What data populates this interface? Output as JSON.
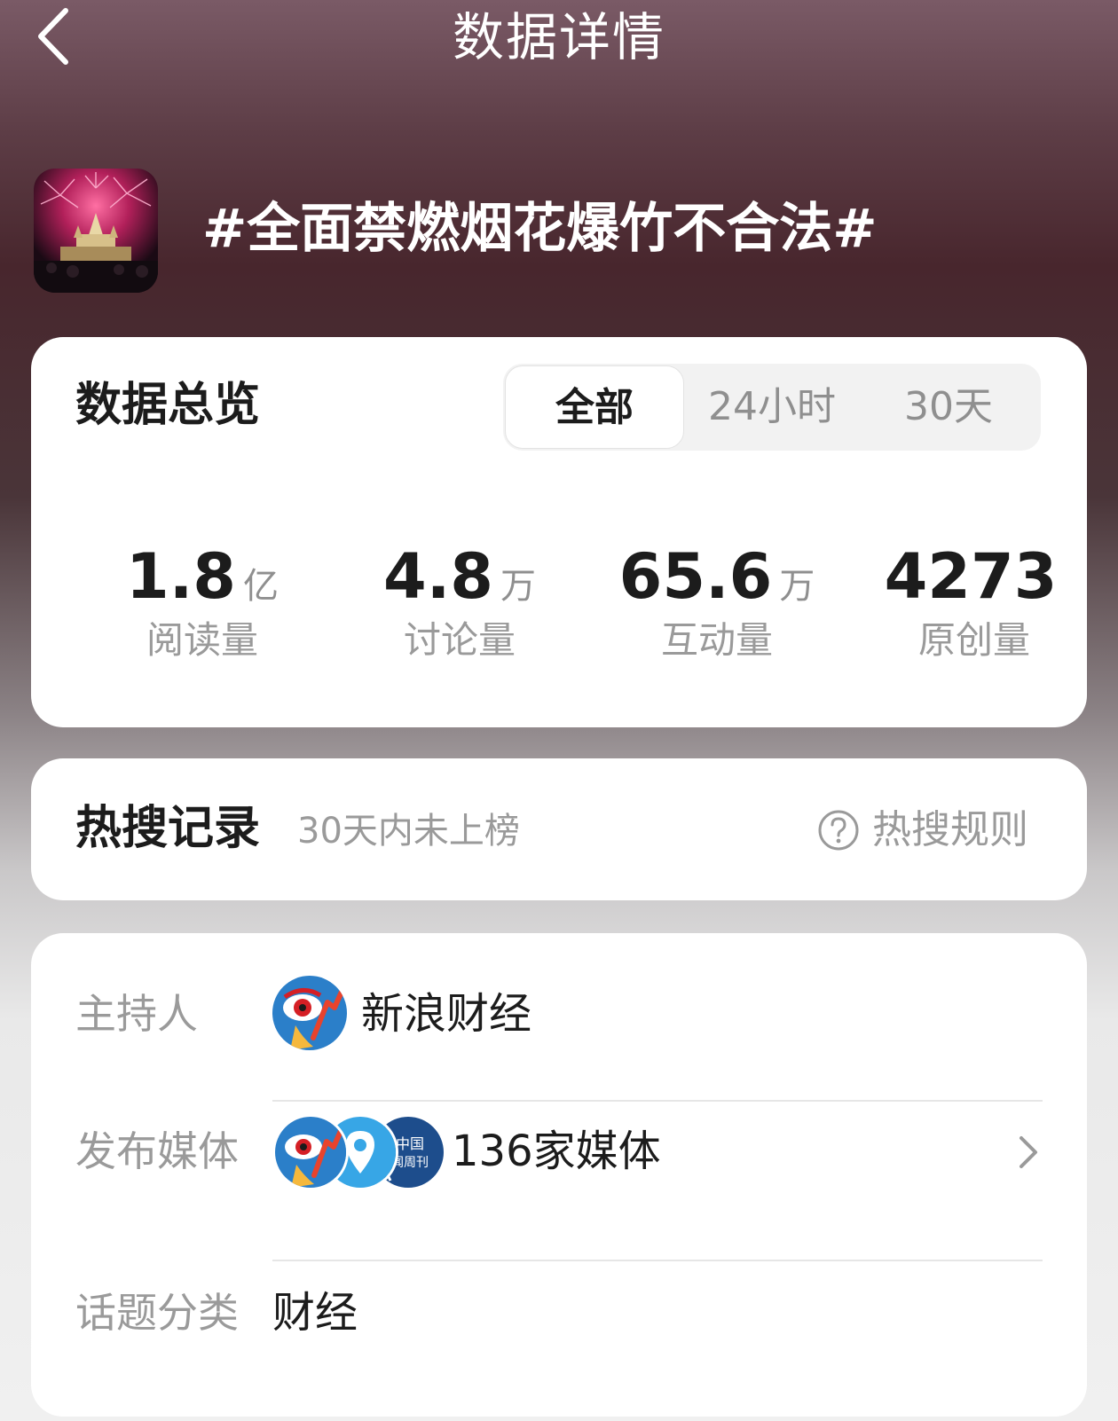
{
  "header": {
    "title": "数据详情"
  },
  "topic": {
    "title": "#全面禁燃烟花爆竹不合法#"
  },
  "overview": {
    "title": "数据总览",
    "tabs": [
      {
        "label": "全部",
        "active": true
      },
      {
        "label": "24小时",
        "active": false
      },
      {
        "label": "30天",
        "active": false
      }
    ],
    "stats": [
      {
        "value": "1.8",
        "unit": "亿",
        "label": "阅读量"
      },
      {
        "value": "4.8",
        "unit": "万",
        "label": "讨论量"
      },
      {
        "value": "65.6",
        "unit": "万",
        "label": "互动量"
      },
      {
        "value": "4273",
        "unit": "",
        "label": "原创量"
      }
    ]
  },
  "hot_search": {
    "title": "热搜记录",
    "status": "30天内未上榜",
    "rules_label": "热搜规则"
  },
  "info": {
    "host": {
      "label": "主持人",
      "value": "新浪财经"
    },
    "media": {
      "label": "发布媒体",
      "value": "136家媒体",
      "avatar_text": [
        "中国",
        "闻周刊"
      ]
    },
    "category": {
      "label": "话题分类",
      "value": "财经"
    }
  },
  "colors": {
    "accent_text": "#1c1c1c",
    "muted_text": "#9a9a9a",
    "card_bg": "#ffffff",
    "header_bg": "#5d3d46"
  }
}
